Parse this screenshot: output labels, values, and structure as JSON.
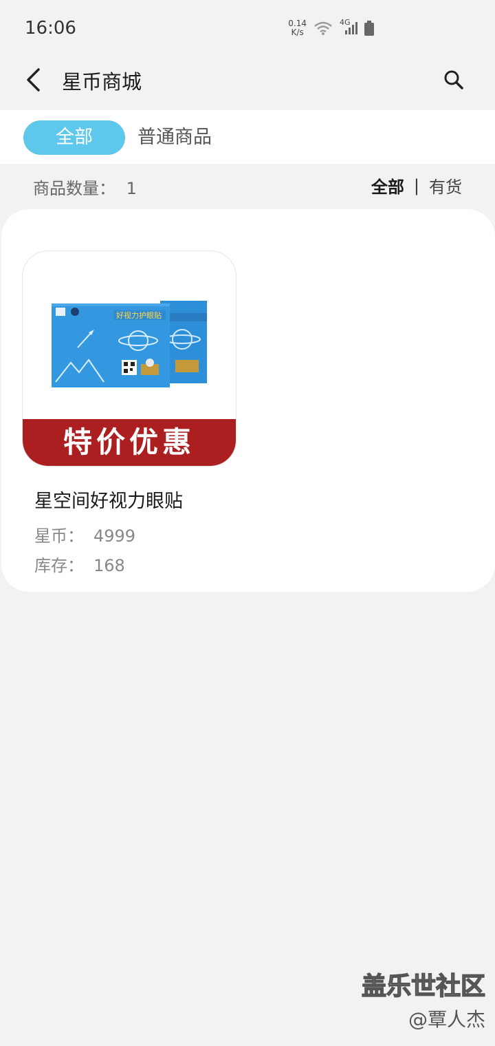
{
  "status_bar": {
    "time": "16:06",
    "speed_value": "0.14",
    "speed_unit": "K/s",
    "network": "4G"
  },
  "nav": {
    "title": "星币商城"
  },
  "tabs": [
    {
      "label": "全部",
      "active": true
    },
    {
      "label": "普通商品",
      "active": false
    }
  ],
  "filter": {
    "count_label": "商品数量：",
    "count_value": "1",
    "option_all": "全部",
    "separator": "|",
    "option_in_stock": "有货"
  },
  "products": [
    {
      "promo": "特价优惠",
      "name": "星空间好视力眼贴",
      "price_label": "星币：",
      "price_value": "4999",
      "stock_label": "库存：",
      "stock_value": "168"
    }
  ],
  "watermark": {
    "brand": "盖乐世社区",
    "user": "@覃人杰"
  },
  "colors": {
    "accent": "#5ec8ec",
    "promo_red": "#ab1f21",
    "background": "#f2f2f2"
  }
}
